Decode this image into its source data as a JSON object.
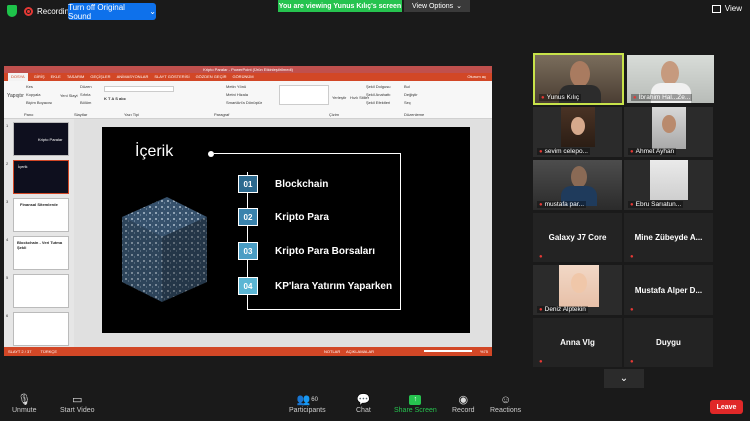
{
  "topbar": {
    "recording": "Recording",
    "orig_sound": "Turn off Original Sound",
    "viewing": "You are viewing Yunus Kılıç's screen",
    "view_options": "View Options",
    "view": "View"
  },
  "ppt": {
    "title": "Kripto Paralar - PowerPoint (Ürün Etkinleştirilmedi)",
    "tabs": [
      "DOSYA",
      "GİRİŞ",
      "EKLE",
      "TASARIM",
      "GEÇİŞLER",
      "ANİMASYONLAR",
      "SLAYT GÖSTERİSİ",
      "GÖZDEN GEÇİR",
      "GÖRÜNÜM"
    ],
    "user": "Oturum aç",
    "ribbon": {
      "paste": "Yapıştır",
      "cut": "Kes",
      "copy": "Kopyala",
      "format_painter": "Biçim Boyacısı",
      "new_slide": "Yeni Slayt",
      "layout": "Düzen",
      "reset": "Sıfırla",
      "section": "Bölüm",
      "arrange": "Yerleştir",
      "quick_styles": "Hızlı Stiller",
      "shape_fill": "Şekil Dolgusu",
      "shape_outline": "Şekil Anahattı",
      "shape_effects": "Şekil Efektleri",
      "find": "Bul",
      "replace": "Değiştir",
      "select": "Seç",
      "text_direction": "Metin Yönü",
      "align_text": "Metni Hizala",
      "smartart": "SmartArt'a Dönüştür",
      "group_clipboard": "Pano",
      "group_slides": "Slaytlar",
      "group_font": "Yazı Tipi",
      "group_paragraph": "Paragraf",
      "group_drawing": "Çizim",
      "group_editing": "Düzenleme"
    },
    "thumb_titles": [
      "Kripto Paralar",
      "İçerik",
      "Finansal Sitemlerde",
      "Blockchain - Veri Tutma Şekli",
      "",
      ""
    ],
    "slide": {
      "title": "İçerik",
      "items": [
        {
          "num": "01",
          "text": "Blockchain"
        },
        {
          "num": "02",
          "text": "Kripto Para"
        },
        {
          "num": "03",
          "text": "Kripto Para Borsaları"
        },
        {
          "num": "04",
          "text": "KP'lara Yatırım Yaparken"
        }
      ]
    },
    "status": {
      "slide": "SLAYT 2 / 37",
      "lang": "TÜRKÇE",
      "notes": "NOTLAR",
      "comments": "AÇIKLAMALAR",
      "zoom": "%75"
    }
  },
  "participants_panel": {
    "tiles": [
      {
        "name": "Yunus Kılıç",
        "video": true
      },
      {
        "name": "İbrahim Hal...Ze...",
        "video": true
      },
      {
        "name": "sevim celepo...",
        "video": true
      },
      {
        "name": "Ahmet Ayhan",
        "video": true
      },
      {
        "name": "mustafa par...",
        "video": true
      },
      {
        "name": "Ebru Sarıatun...",
        "video": true
      },
      {
        "name": "Galaxy J7 Core",
        "video": false
      },
      {
        "name": "Mine Zübeyde A...",
        "video": false
      },
      {
        "name": "Deniz Alptekin",
        "video": true
      },
      {
        "name": "Mustafa Alper D...",
        "video": false
      },
      {
        "name": "Anna Vlg",
        "video": false
      },
      {
        "name": "Duygu",
        "video": false
      }
    ]
  },
  "toolbar": {
    "unmute": "Unmute",
    "start_video": "Start Video",
    "participants": "Participants",
    "participants_count": "60",
    "chat": "Chat",
    "share_screen": "Share Screen",
    "record": "Record",
    "reactions": "Reactions",
    "leave": "Leave"
  },
  "colors": {
    "zoom_green": "#26c34f",
    "zoom_blue": "#0e71eb",
    "ppt_accent": "#d24726",
    "leave_red": "#e02828"
  }
}
